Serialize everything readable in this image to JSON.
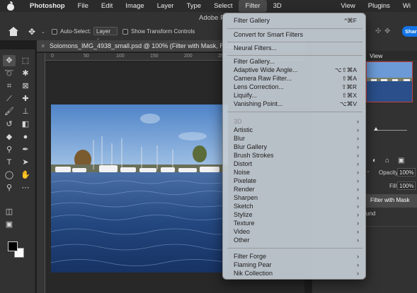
{
  "menubar": {
    "app": "Photoshop",
    "items": [
      "File",
      "Edit",
      "Image",
      "Layer",
      "Type",
      "Select",
      "Filter",
      "3D"
    ],
    "right_items": [
      "View",
      "Plugins",
      "Wi"
    ]
  },
  "window": {
    "title_fragment": "Adobe P"
  },
  "options_bar": {
    "auto_select_label": "Auto-Select:",
    "auto_select_value": "Layer",
    "show_transform_label": "Show Transform Controls",
    "share_label": "Shar"
  },
  "document": {
    "tab_close": "×",
    "tab_title": "Solomons_IMG_4938_small.psd @ 100% (Filter with Mask, RGB/8*"
  },
  "ruler": {
    "ticks": [
      "0",
      "50",
      "100",
      "150",
      "200",
      "250",
      "300",
      "350",
      "400"
    ]
  },
  "navigator": {
    "tab_label": "View"
  },
  "layers": {
    "opacity_label": "Opacity:",
    "opacity_value": "100%",
    "fill_label": "Fill:",
    "fill_value": "100%",
    "active_layer": "Filter with Mask",
    "background_layer_fragment": "und"
  },
  "filter_menu": {
    "items": [
      {
        "label": "Filter Gallery",
        "shortcut": "^⌘F"
      },
      {
        "label": "Convert for Smart Filters"
      },
      {
        "label": "Neural Filters..."
      },
      {
        "label": "Filter Gallery..."
      },
      {
        "label": "Adaptive Wide Angle...",
        "shortcut": "⌥⇧⌘A"
      },
      {
        "label": "Camera Raw Filter...",
        "shortcut": "⇧⌘A"
      },
      {
        "label": "Lens Correction...",
        "shortcut": "⇧⌘R"
      },
      {
        "label": "Liquify...",
        "shortcut": "⇧⌘X"
      },
      {
        "label": "Vanishing Point...",
        "shortcut": "⌥⌘V"
      },
      {
        "label": "3D",
        "submenu": true,
        "disabled": true
      },
      {
        "label": "Artistic",
        "submenu": true
      },
      {
        "label": "Blur",
        "submenu": true
      },
      {
        "label": "Blur Gallery",
        "submenu": true
      },
      {
        "label": "Brush Strokes",
        "submenu": true
      },
      {
        "label": "Distort",
        "submenu": true
      },
      {
        "label": "Noise",
        "submenu": true
      },
      {
        "label": "Pixelate",
        "submenu": true
      },
      {
        "label": "Render",
        "submenu": true
      },
      {
        "label": "Sharpen",
        "submenu": true
      },
      {
        "label": "Sketch",
        "submenu": true
      },
      {
        "label": "Stylize",
        "submenu": true
      },
      {
        "label": "Texture",
        "submenu": true
      },
      {
        "label": "Video",
        "submenu": true
      },
      {
        "label": "Other",
        "submenu": true
      },
      {
        "label": "Filter Forge",
        "submenu": true
      },
      {
        "label": "Flaming Pear",
        "submenu": true
      },
      {
        "label": "Nik Collection",
        "submenu": true
      }
    ],
    "submenu_arrow": "›"
  },
  "colors": {
    "accent_blue": "#1473e6",
    "menu_bg": "#c4ccd4",
    "sky": "#5f8fcf",
    "water": "#1f3f78"
  }
}
